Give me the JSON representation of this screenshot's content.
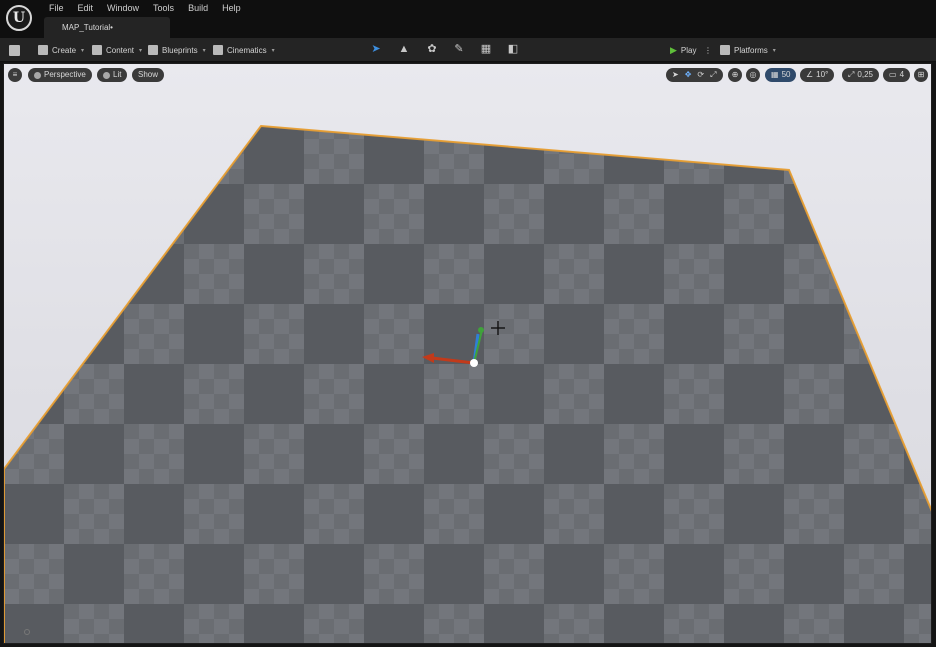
{
  "app": {
    "logo_glyph": "U",
    "doc_tab": "MAP_Tutorial•"
  },
  "menu": [
    "File",
    "Edit",
    "Window",
    "Tools",
    "Build",
    "Help"
  ],
  "toolbar": {
    "save_icon": "save-icon",
    "create": "Create",
    "content": "Content",
    "blueprints": "Blueprints",
    "cinematics": "Cinematics",
    "play": "Play",
    "platforms": "Platforms",
    "mode_icons": [
      "select-mode-icon",
      "landscape-mode-icon",
      "foliage-mode-icon",
      "mesh-paint-mode-icon",
      "fracture-mode-icon",
      "brush-edit-mode-icon"
    ]
  },
  "viewport": {
    "perspective": "Perspective",
    "lit": "Lit",
    "show": "Show",
    "grid_snap": "50",
    "rotation_snap": "10°",
    "scale_snap": "0,25",
    "camera_speed": "4"
  },
  "colors": {
    "accent_orange": "#e8a23a",
    "floor_dark": "#5a5d63",
    "floor_light": "#7b7e84",
    "gizmo_x": "#c23a1a",
    "gizmo_y": "#3fa33a",
    "gizmo_z": "#2f7fd6"
  }
}
